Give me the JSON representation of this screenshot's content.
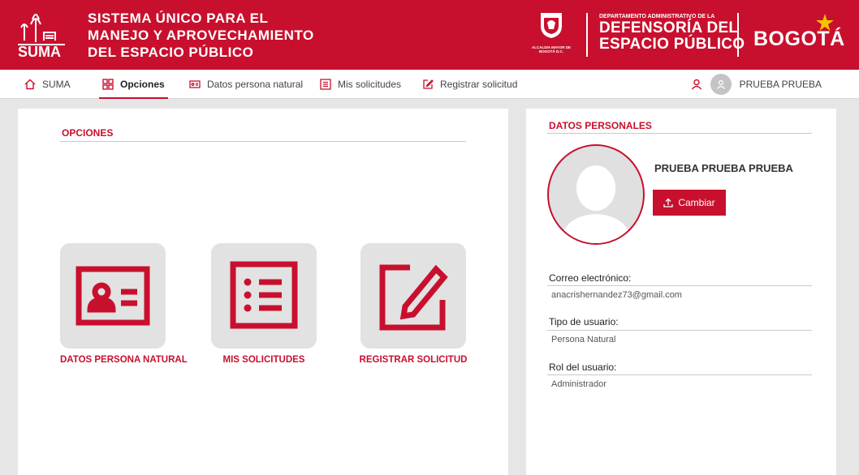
{
  "header": {
    "suma_logo_text": "SUMA",
    "system_title_lines": [
      "SISTEMA ÚNICO PARA EL",
      "MANEJO Y APROVECHAMIENTO",
      "DEL ESPACIO PÚBLICO"
    ],
    "alcaldia_text": "ALCALDÍA MAYOR DE BOGOTÁ D.C.",
    "dadep_small": "DEPARTAMENTO ADMINISTRATIVO DE LA",
    "dadep_big_1": "DEFENSORÍA DEL",
    "dadep_big_2": "ESPACIO PÚBLICO",
    "bogota": "BOGOTÁ"
  },
  "nav": {
    "items": [
      {
        "label": "SUMA",
        "icon": "home-icon"
      },
      {
        "label": "Opciones",
        "icon": "grid-icon",
        "active": true
      },
      {
        "label": "Datos persona natural",
        "icon": "id-card-icon"
      },
      {
        "label": "Mis solicitudes",
        "icon": "list-icon"
      },
      {
        "label": "Registrar solicitud",
        "icon": "edit-icon"
      }
    ],
    "user_name": "PRUEBA PRUEBA"
  },
  "options": {
    "title": "OPCIONES",
    "tiles": [
      {
        "label": "DATOS PERSONA NATURAL",
        "icon": "id-card-icon"
      },
      {
        "label": "MIS SOLICITUDES",
        "icon": "list-icon"
      },
      {
        "label": "REGISTRAR SOLICITUD",
        "icon": "edit-icon"
      }
    ]
  },
  "personal": {
    "title": "DATOS PERSONALES",
    "full_name": "PRUEBA PRUEBA PRUEBA",
    "change_button": "Cambiar",
    "fields": [
      {
        "label": "Correo electrónico:",
        "value": "anacrishernandez73@gmail.com"
      },
      {
        "label": "Tipo de usuario:",
        "value": "Persona Natural"
      },
      {
        "label": "Rol del usuario:",
        "value": "Administrador"
      }
    ]
  },
  "colors": {
    "brand_red": "#c8102e",
    "background": "#e6e6e6",
    "tile_gray": "#e2e2e2"
  }
}
